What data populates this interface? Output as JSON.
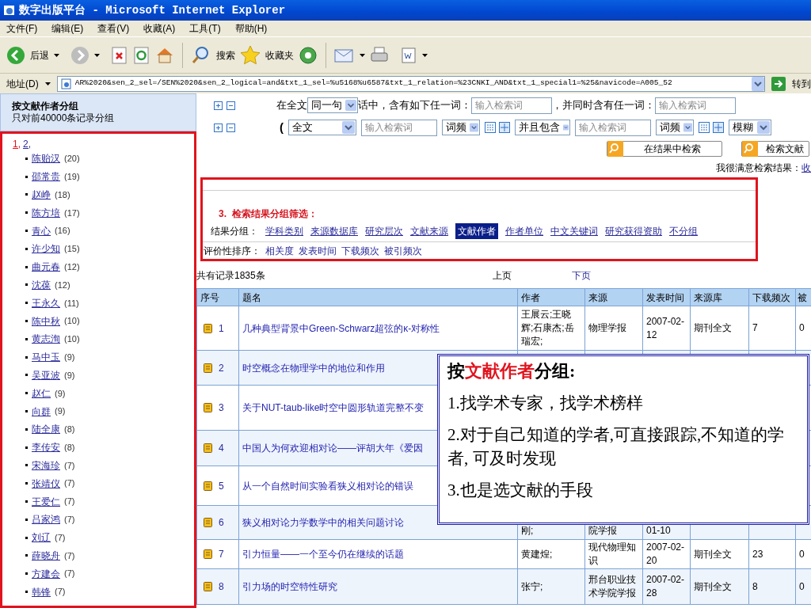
{
  "window": {
    "title": "数字出版平台 - Microsoft Internet Explorer"
  },
  "menu": [
    "文件(F)",
    "编辑(E)",
    "查看(V)",
    "收藏(A)",
    "工具(T)",
    "帮助(H)"
  ],
  "toolbar": {
    "back": "后退",
    "search": "搜索",
    "favorites": "收藏夹"
  },
  "address": {
    "label": "地址(D)",
    "value": "AR%2020&sen_2_sel=/SEN%2020&sen_2_logical=and&txt_1_sel=%u5168%u6587&txt_1_relation=%23CNKI_AND&txt_1_special1=%25&navicode=A005_52",
    "go": "转到"
  },
  "sidebar": {
    "title": "按文献作者分组",
    "subtitle": "只对前40000条记录分组",
    "pages": [
      {
        "label": "1,",
        "selected": true
      },
      {
        "label": "2,",
        "selected": false
      }
    ],
    "authors": [
      {
        "name": "陈贻汉",
        "count": "(20)"
      },
      {
        "name": "邵常贵",
        "count": "(19)"
      },
      {
        "name": "赵峥",
        "count": "(18)"
      },
      {
        "name": "陈方培",
        "count": "(17)"
      },
      {
        "name": "青心",
        "count": "(16)"
      },
      {
        "name": "许少知",
        "count": "(15)"
      },
      {
        "name": "曲元春",
        "count": "(12)"
      },
      {
        "name": "沈葆",
        "count": "(12)"
      },
      {
        "name": "王永久",
        "count": "(11)"
      },
      {
        "name": "陈中秋",
        "count": "(10)"
      },
      {
        "name": "黄志洵",
        "count": "(10)"
      },
      {
        "name": "马中玉",
        "count": "(9)"
      },
      {
        "name": "吴亚波",
        "count": "(9)"
      },
      {
        "name": "赵仁",
        "count": "(9)"
      },
      {
        "name": "向群",
        "count": "(9)"
      },
      {
        "name": "陆全康",
        "count": "(8)"
      },
      {
        "name": "李传安",
        "count": "(8)"
      },
      {
        "name": "宋海珍",
        "count": "(7)"
      },
      {
        "name": "张靖仪",
        "count": "(7)"
      },
      {
        "name": "王爱仁",
        "count": "(7)"
      },
      {
        "name": "吕家鸿",
        "count": "(7)"
      },
      {
        "name": "刘辽",
        "count": "(7)"
      },
      {
        "name": "薛晓舟",
        "count": "(7)"
      },
      {
        "name": "方建会",
        "count": "(7)"
      },
      {
        "name": "韩锋",
        "count": "(7)"
      }
    ]
  },
  "search": {
    "line1": {
      "prefix": "在全文",
      "scope": "同一句",
      "middle": "话中，含有如下任一词：",
      "placeholder1": "输入检索词",
      "joiner": "，并同时含有任一词：",
      "placeholder2": "输入检索词"
    },
    "line2": {
      "paren": "(",
      "field": "全文",
      "placeholder1": "输入检索词",
      "freq1": "词频",
      "logic": "并且包含",
      "placeholder2": "输入检索词",
      "freq2": "词频",
      "match": "模糊"
    },
    "buttons": [
      "在结果中检索",
      "检索文献"
    ],
    "feedback": "我很满意检索结果：",
    "feedback_link": "收"
  },
  "grouping": {
    "heading": "3.  检索结果分组筛选：",
    "label": "结果分组：",
    "options": [
      {
        "label": "学科类别",
        "selected": false
      },
      {
        "label": "来源数据库",
        "selected": false
      },
      {
        "label": "研究层次",
        "selected": false
      },
      {
        "label": "文献来源",
        "selected": false
      },
      {
        "label": "文献作者",
        "selected": true
      },
      {
        "label": "作者单位",
        "selected": false
      },
      {
        "label": "中文关键词",
        "selected": false
      },
      {
        "label": "研究获得资助",
        "selected": false
      },
      {
        "label": "不分组",
        "selected": false
      }
    ],
    "sort_label": "评价性排序：",
    "sort_options": [
      "相关度",
      "发表时间",
      "下载频次",
      "被引频次"
    ]
  },
  "results": {
    "count": "共有记录1835条",
    "prev": "上页",
    "next": "下页",
    "columns": [
      "序号",
      "题名",
      "作者",
      "来源",
      "发表时间",
      "来源库",
      "下载频次",
      "被"
    ],
    "rows": [
      {
        "index": "1",
        "title": "几种典型背景中Green-Schwarz超弦的κ-对称性",
        "author": "王展云;王晓辉;石康杰;岳瑞宏;",
        "source": "物理学报",
        "date": "2007-02-12",
        "library": "期刊全文",
        "downloads": "7",
        "cited": "0"
      },
      {
        "index": "2",
        "title": "时空概念在物理学中的地位和作用"
      },
      {
        "index": "3",
        "title": "关于NUT-taub-like时空中圆形轨道完整不变"
      },
      {
        "index": "4",
        "title": "中国人为何欢迎相对论——评胡大年《爱因"
      },
      {
        "index": "5",
        "title": "从一个自然时间实验看狭义相对论的错误"
      },
      {
        "index": "6",
        "title": "狭义相对论力学数学中的相关问题讨论",
        "author": "刚;",
        "source": "院学报",
        "date": "01-10"
      },
      {
        "index": "7",
        "title": "引力恒量——一个至今仍在继续的话题",
        "author": "黄建煌;",
        "source": "现代物理知识",
        "date": "2007-02-20",
        "library": "期刊全文",
        "downloads": "23",
        "cited": "0"
      },
      {
        "index": "8",
        "title": "引力场的时空特性研究",
        "author": "张宁;",
        "source": "邢台职业技术学院学报",
        "date": "2007-02-28",
        "library": "期刊全文",
        "downloads": "8",
        "cited": "0"
      }
    ]
  },
  "callout": {
    "title": [
      {
        "text": "按",
        "highlight": false
      },
      {
        "text": "文献作者",
        "highlight": true
      },
      {
        "text": "分组:",
        "highlight": false
      }
    ],
    "points": [
      "1.找学术专家，找学术榜样",
      "2.对于自己知道的学者,可直接跟踪,不知道的学者, 可及时发现",
      "3.也是选文献的手段"
    ]
  }
}
